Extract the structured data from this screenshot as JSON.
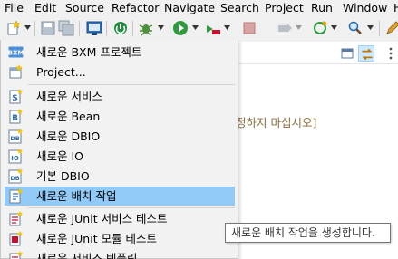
{
  "menubar": {
    "items": [
      "File",
      "Edit",
      "Source",
      "Refactor",
      "Navigate",
      "Search",
      "Project",
      "Run",
      "Window",
      "H"
    ]
  },
  "toolbar": {
    "icons": [
      "new-wizard-icon",
      "save-icon",
      "save-all-icon",
      "terminal-icon",
      "skip-breakpoints-icon",
      "debug-icon",
      "run-icon",
      "external-tools-icon",
      "stop-icon",
      "build-icon",
      "refresh-icon",
      "search-icon"
    ]
  },
  "dropdown": {
    "items": [
      {
        "label": "새로운 BXM 프로젝트",
        "icon": "bxm-project-icon"
      },
      {
        "label": "Project...",
        "icon": "project-icon"
      },
      {
        "label": "새로운 서비스",
        "icon": "service-icon"
      },
      {
        "label": "새로운 Bean",
        "icon": "bean-icon"
      },
      {
        "label": "새로운 DBIO",
        "icon": "dbio-icon"
      },
      {
        "label": "새로운 IO",
        "icon": "io-icon"
      },
      {
        "label": "기본 DBIO",
        "icon": "default-dbio-icon"
      },
      {
        "label": "새로운 배치 작업",
        "icon": "batch-job-icon"
      },
      {
        "label": "새로운 JUnit 서비스 테스트",
        "icon": "junit-service-test-icon"
      },
      {
        "label": "새로운 JUnit 모듈 테스트",
        "icon": "junit-module-test-icon"
      },
      {
        "label": "새로운 서비스 템플릿",
        "icon": "service-template-icon"
      }
    ],
    "highlighted_index": 7
  },
  "editor": {
    "hint_text": "정하지 마십시오]"
  },
  "tooltip": {
    "text": "새로운 배치 작업을 생성합니다."
  },
  "colors": {
    "highlight": "#91c9f7",
    "menu_bg": "#f2f2f2",
    "hint": "#8a6d3b"
  }
}
